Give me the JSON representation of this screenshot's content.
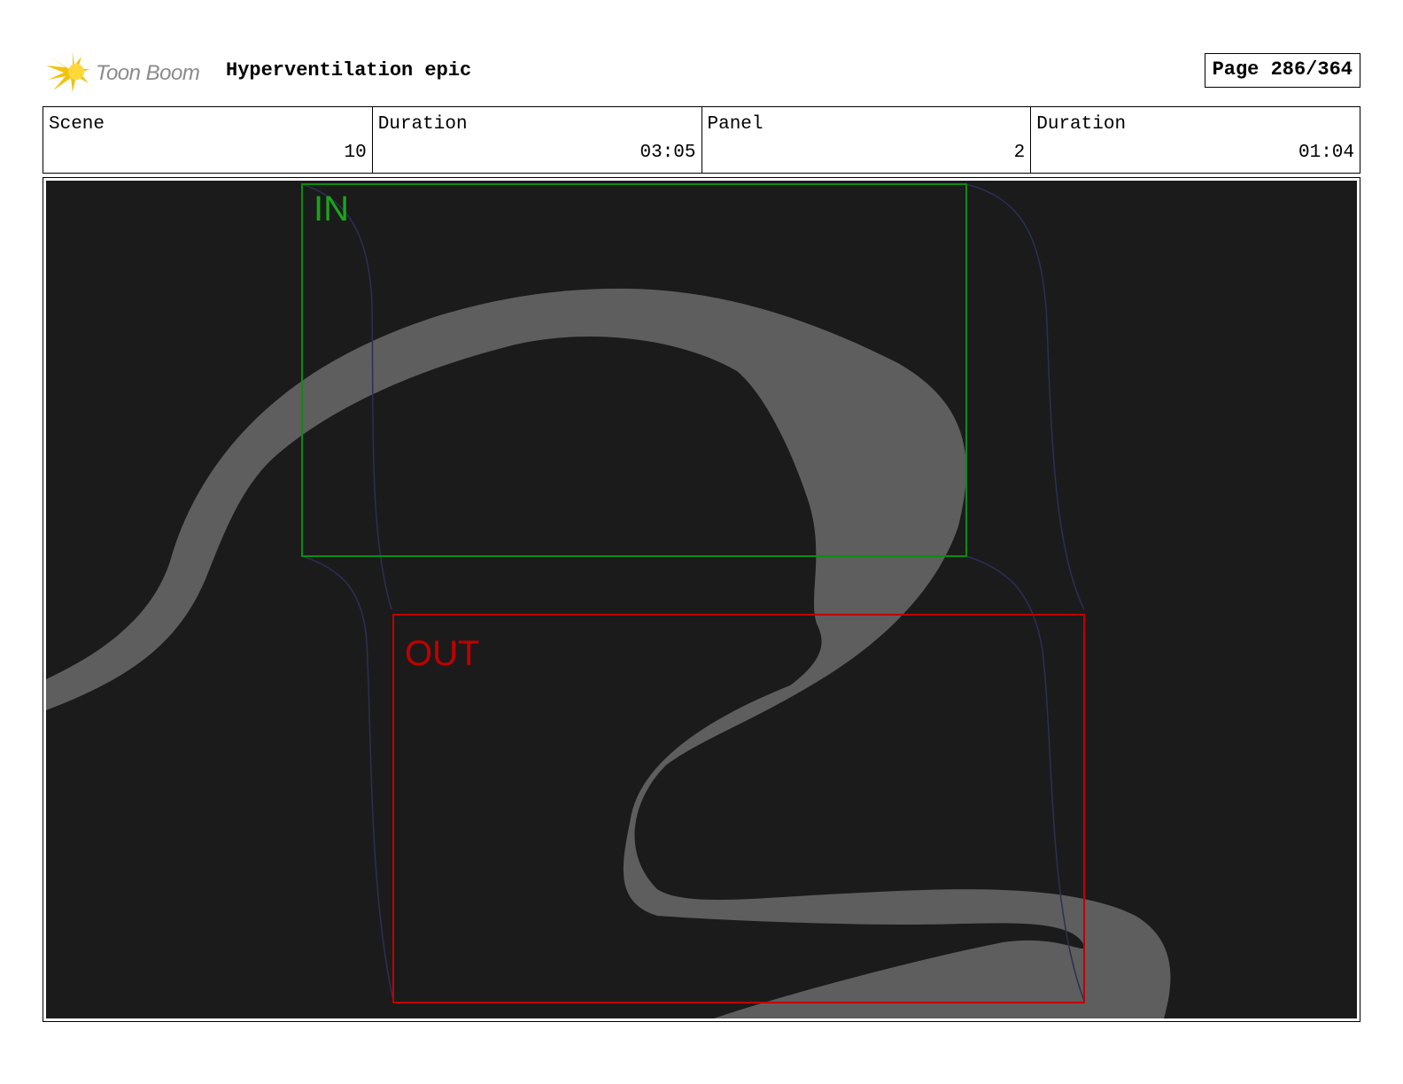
{
  "header": {
    "logo_text": "Toon Boom",
    "title": "Hyperventilation epic",
    "page_label": "Page 286/364"
  },
  "info": [
    {
      "label": "Scene",
      "value": "10"
    },
    {
      "label": "Duration",
      "value": "03:05"
    },
    {
      "label": "Panel",
      "value": "2"
    },
    {
      "label": "Duration",
      "value": "01:04"
    }
  ],
  "panel": {
    "in_label": "IN",
    "out_label": "OUT",
    "colors": {
      "background": "#1b1b1b",
      "path": "#5e5e5e",
      "in_frame": "#0f8a0f",
      "out_frame": "#c00000",
      "motion_guides": "#2b2f55"
    }
  }
}
